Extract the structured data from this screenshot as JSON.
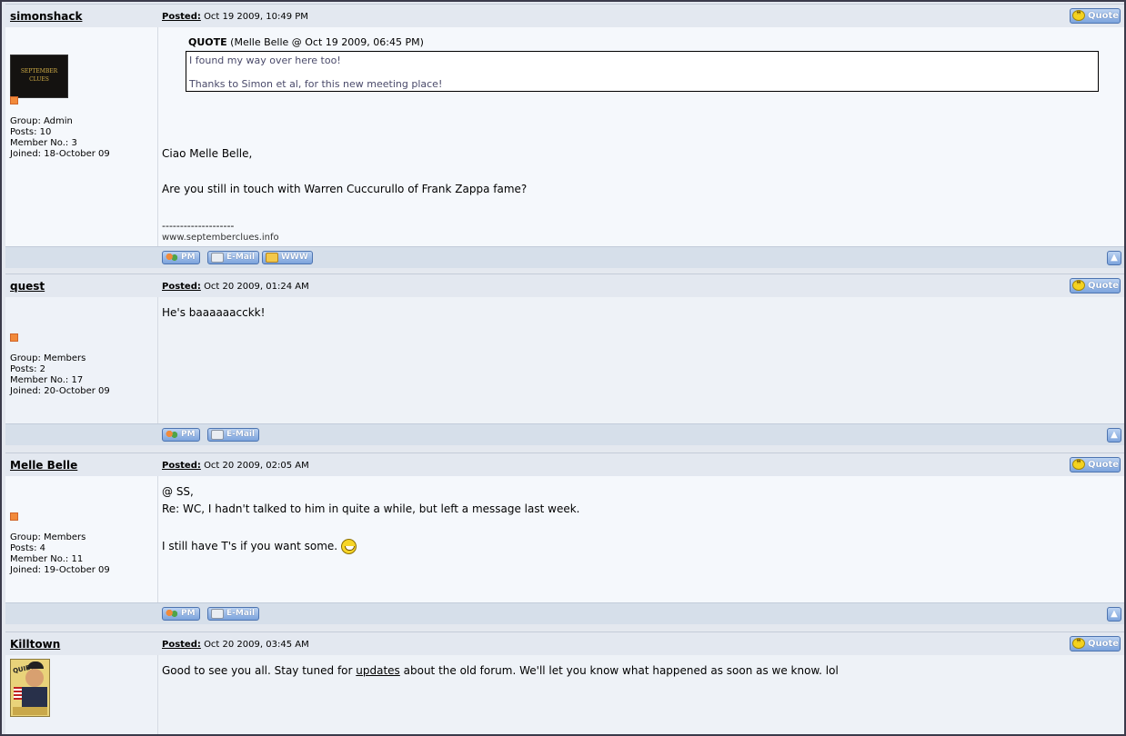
{
  "posts": [
    {
      "author": "simonshack",
      "posted_label": "Posted:",
      "date": "Oct 19 2009, 10:49 PM",
      "quote_button": "Quote",
      "avatar_text": "SEPTEMBER CLUES",
      "group": "Group: Admin",
      "posts": "Posts: 10",
      "member_no": "Member No.: 3",
      "joined": "Joined: 18-October 09",
      "quote": {
        "label": "QUOTE",
        "source": "(Melle Belle @ Oct 19 2009, 06:45 PM)",
        "line1": "I found my way over here too!",
        "line2": "Thanks to Simon et al, for this new meeting place!"
      },
      "message_line1": "Ciao Melle Belle,",
      "message_line2": "Are you still in touch with Warren Cuccurullo of Frank Zappa fame?",
      "signature_line": "--------------------",
      "signature_url": "www.septemberclues.info",
      "buttons": {
        "pm": "PM",
        "email": "E-Mail",
        "www": "WWW"
      }
    },
    {
      "author": "quest",
      "posted_label": "Posted:",
      "date": "Oct 20 2009, 01:24 AM",
      "quote_button": "Quote",
      "group": "Group: Members",
      "posts": "Posts: 2",
      "member_no": "Member No.: 17",
      "joined": "Joined: 20-October 09",
      "message_line1": "He's baaaaaacckk!",
      "buttons": {
        "pm": "PM",
        "email": "E-Mail"
      }
    },
    {
      "author": "Melle Belle",
      "posted_label": "Posted:",
      "date": "Oct 20 2009, 02:05 AM",
      "quote_button": "Quote",
      "group": "Group: Members",
      "posts": "Posts: 4",
      "member_no": "Member No.: 11",
      "joined": "Joined: 19-October 09",
      "message_line1": "@ SS,",
      "message_line2": "Re: WC, I hadn't talked to him in quite a while, but left a message last week.",
      "message_line3": "I still have T's if you want some.",
      "buttons": {
        "pm": "PM",
        "email": "E-Mail"
      }
    },
    {
      "author": "Killtown",
      "posted_label": "Posted:",
      "date": "Oct 20 2009, 03:45 AM",
      "quote_button": "Quote",
      "avatar_text": "QUIET!",
      "message_before": "Good to see you all. Stay tuned for ",
      "message_link": "updates",
      "message_after": " about the old forum. We'll let you know what happened as soon as we know. lol"
    }
  ],
  "icons": {
    "quote": "quote-icon",
    "pm": "pm-icon",
    "email": "email-icon",
    "www": "www-icon",
    "top": "arrow-up-icon",
    "status": "status-icon",
    "smiley": "smiley-icon"
  },
  "colors": {
    "header_bg": "#e3e8f0",
    "body_bg": "#eef2f7",
    "footer_bg": "#d6dfea",
    "button_blue": "#7ca3dc",
    "status_orange": "#f28a3a"
  }
}
